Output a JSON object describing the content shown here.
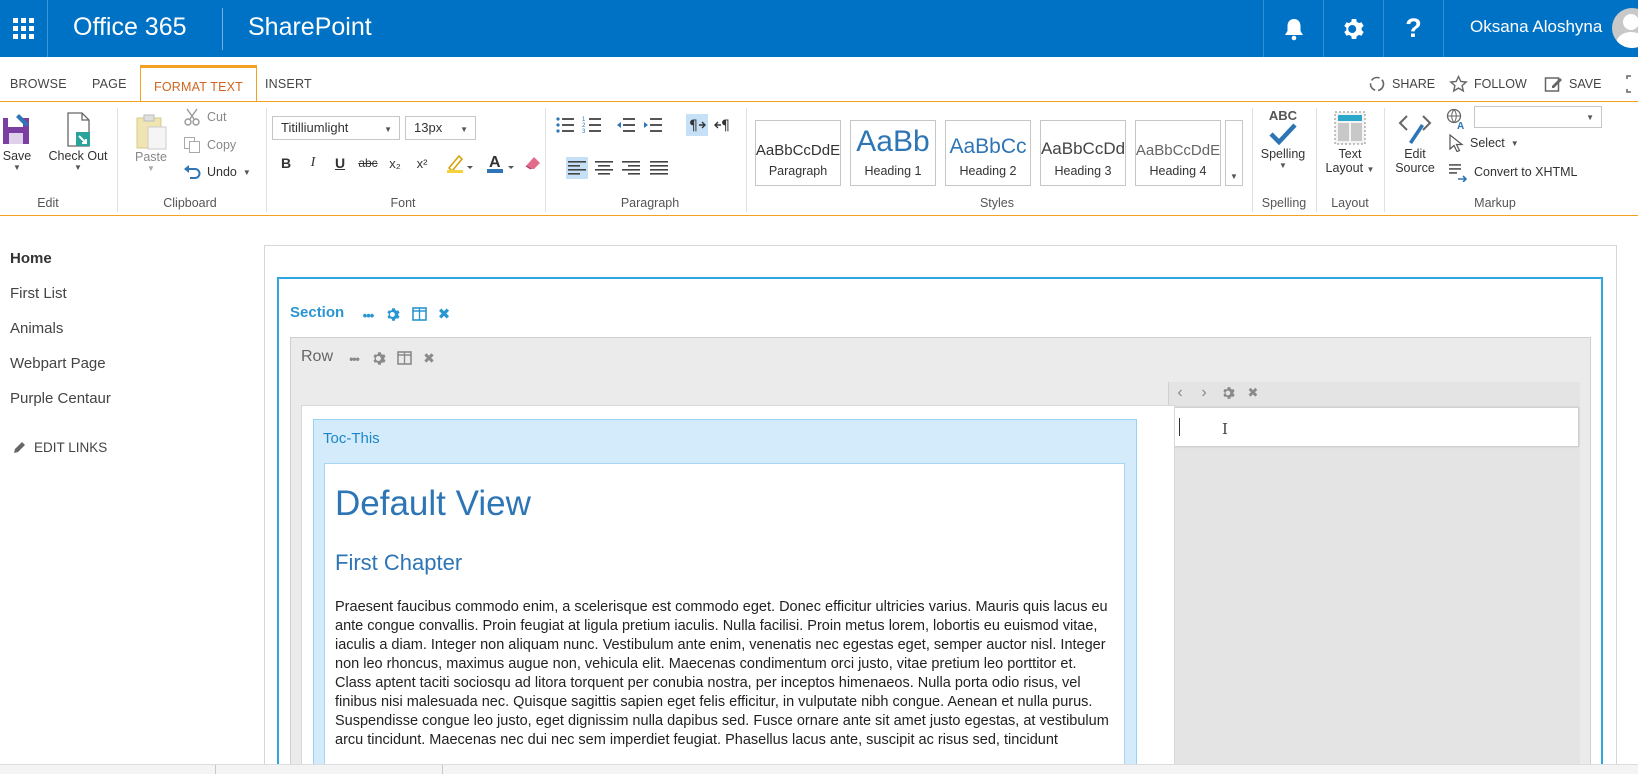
{
  "suitebar": {
    "brand": "Office 365",
    "app": "SharePoint",
    "user_name": "Oksana Aloshyna",
    "accent": "#0072c6"
  },
  "ribbon_tabs": {
    "tabs": [
      "BROWSE",
      "PAGE",
      "FORMAT TEXT",
      "INSERT"
    ],
    "active": "FORMAT TEXT",
    "actions": {
      "share": "SHARE",
      "follow": "FOLLOW",
      "save": "SAVE"
    }
  },
  "ribbon": {
    "edit": {
      "label": "Edit",
      "save": "Save",
      "check_out": "Check Out"
    },
    "clipboard": {
      "label": "Clipboard",
      "paste": "Paste",
      "cut": "Cut",
      "copy": "Copy",
      "undo": "Undo"
    },
    "font": {
      "label": "Font",
      "family": "Titilliumlight",
      "size": "13px",
      "bold": "B",
      "italic": "I",
      "underline": "U",
      "strike": "abc",
      "subscript": "x₂",
      "superscript": "x²"
    },
    "paragraph": {
      "label": "Paragraph"
    },
    "styles": {
      "label": "Styles",
      "items": [
        {
          "sample": "AaBbCcDdE",
          "name": "Paragraph"
        },
        {
          "sample": "AaBb",
          "name": "Heading 1"
        },
        {
          "sample": "AaBbCc",
          "name": "Heading 2"
        },
        {
          "sample": "AaBbCcDd",
          "name": "Heading 3"
        },
        {
          "sample": "AaBbCcDdE",
          "name": "Heading 4"
        }
      ]
    },
    "spelling": {
      "label": "Spelling",
      "button": "Spelling",
      "abc": "ABC"
    },
    "layout": {
      "label": "Layout",
      "button_line1": "Text",
      "button_line2": "Layout"
    },
    "markup": {
      "label": "Markup",
      "edit_source_line1": "Edit",
      "edit_source_line2": "Source",
      "select": "Select",
      "convert": "Convert to XHTML",
      "language_value": ""
    }
  },
  "nav": {
    "items": [
      "Home",
      "First List",
      "Animals",
      "Webpart Page",
      "Purple Centaur"
    ],
    "current": "Home",
    "edit_links": "EDIT LINKS"
  },
  "canvas": {
    "section_label": "Section",
    "row_label": "Row",
    "webpart_title": "Toc-This",
    "heading1": "Default View",
    "heading2": "First Chapter",
    "paragraph": "Praesent faucibus commodo enim, a scelerisque est commodo eget. Donec efficitur ultricies varius. Mauris quis lacus eu ante congue convallis. Proin feugiat at ligula pretium iaculis. Nulla facilisi. Proin metus lorem, lobortis eu euismod vitae, iaculis a diam. Integer non aliquam nunc. Vestibulum ante enim, venenatis nec egestas eget, semper auctor nisl. Integer non leo rhoncus, maximus augue non, vehicula elit. Maecenas condimentum orci justo, vitae pretium leo porttitor et. Class aptent taciti sociosqu ad litora torquent per conubia nostra, per inceptos himenaeos. Nulla porta odio risus, vel finibus nisi malesuada nec. Quisque sagittis sapien eget felis efficitur, in vulputate nibh congue. Aenean et nulla purus. Suspendisse congue leo justo, eget dignissim nulla dapibus sed. Fusce ornare ante sit amet justo egestas, at vestibulum arcu tincidunt. Maecenas nec dui nec sem imperdiet feugiat. Phasellus lacus ante, suscipit ac risus sed, tincidunt"
  }
}
